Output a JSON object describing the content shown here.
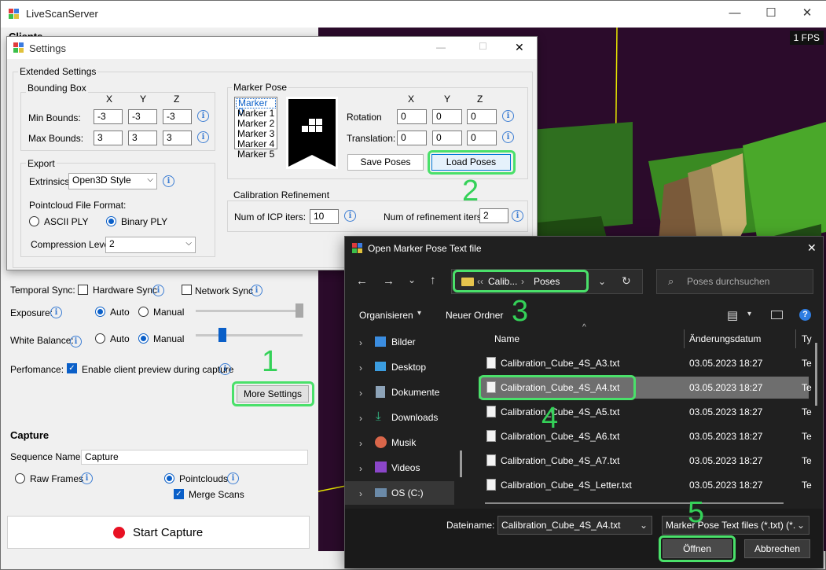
{
  "main": {
    "title": "LiveScanServer",
    "minimize": "—",
    "maximize": "☐",
    "close": "✕",
    "fps": "1 FPS",
    "clients_partial": "Clients",
    "temporal_sync_label": "Temporal Sync:",
    "hardware_sync": "Hardware Sync",
    "network_sync": "Network Sync",
    "exposure_label": "Exposure:",
    "auto": "Auto",
    "manual": "Manual",
    "white_balance_label": "White Balance:",
    "performance_label": "Perfomance:",
    "client_preview": "Enable client preview during capture",
    "more_settings": "More Settings",
    "capture_heading": "Capture",
    "sequence_name_label": "Sequence Name:",
    "sequence_name_value": "Capture",
    "raw_frames": "Raw Frames",
    "pointclouds": "Pointclouds",
    "merge_scans": "Merge Scans",
    "start_capture": "Start Capture"
  },
  "settings": {
    "title": "Settings",
    "extended": "Extended Settings",
    "bounding_box": "Bounding Box",
    "x": "X",
    "y": "Y",
    "z": "Z",
    "min_bounds": "Min Bounds:",
    "max_bounds": "Max Bounds:",
    "min_values": [
      "-3",
      "-3",
      "-3"
    ],
    "max_values": [
      "3",
      "3",
      "3"
    ],
    "export": "Export",
    "extrinsics_label": "Extrinsics",
    "extrinsics_value": "Open3D Style",
    "pointcloud_format": "Pointcloud File Format:",
    "ascii_ply": "ASCII PLY",
    "binary_ply": "Binary PLY",
    "compression_label": "Compression Level:",
    "compression_value": "2",
    "marker_pose": "Marker Pose",
    "markers": [
      "Marker 0",
      "Marker 1",
      "Marker 2",
      "Marker 3",
      "Marker 4",
      "Marker 5"
    ],
    "rotation": "Rotation",
    "translation": "Translation:",
    "rot_values": [
      "0",
      "0",
      "0"
    ],
    "trans_values": [
      "0",
      "0",
      "0"
    ],
    "save_poses": "Save Poses",
    "load_poses": "Load Poses",
    "calibration_refinement": "Calibration Refinement",
    "icp_label": "Num of ICP iters:",
    "icp_value": "10",
    "refinement_label": "Num of refinement iters:",
    "refinement_value": "2"
  },
  "dialog": {
    "title": "Open Marker Pose Text file",
    "breadcrumb": [
      "Calib...",
      "Poses"
    ],
    "search_placeholder": "Poses durchsuchen",
    "organize": "Organisieren",
    "new_folder": "Neuer Ordner",
    "nav": [
      "Bilder",
      "Desktop",
      "Dokumente",
      "Downloads",
      "Musik",
      "Videos",
      "OS (C:)"
    ],
    "col_name": "Name",
    "col_date": "Änderungsdatum",
    "col_type": "Ty",
    "files": [
      {
        "name": "Calibration_Cube_4S_A3.txt",
        "date": "03.05.2023 18:27",
        "type": "Te"
      },
      {
        "name": "Calibration_Cube_4S_A4.txt",
        "date": "03.05.2023 18:27",
        "type": "Te"
      },
      {
        "name": "Calibration_Cube_4S_A5.txt",
        "date": "03.05.2023 18:27",
        "type": "Te"
      },
      {
        "name": "Calibration_Cube_4S_A6.txt",
        "date": "03.05.2023 18:27",
        "type": "Te"
      },
      {
        "name": "Calibration_Cube_4S_A7.txt",
        "date": "03.05.2023 18:27",
        "type": "Te"
      },
      {
        "name": "Calibration_Cube_4S_Letter.txt",
        "date": "03.05.2023 18:27",
        "type": "Te"
      }
    ],
    "filename_label": "Dateiname:",
    "filename_value": "Calibration_Cube_4S_A4.txt",
    "filter_value": "Marker Pose Text files (*.txt) (*.",
    "open": "Öffnen",
    "cancel": "Abbrechen"
  },
  "annotations": [
    "1",
    "2",
    "3",
    "4",
    "5"
  ],
  "colors": {
    "highlight": "#4ae06a",
    "accent": "#0a5fc8",
    "record": "#e81123"
  }
}
